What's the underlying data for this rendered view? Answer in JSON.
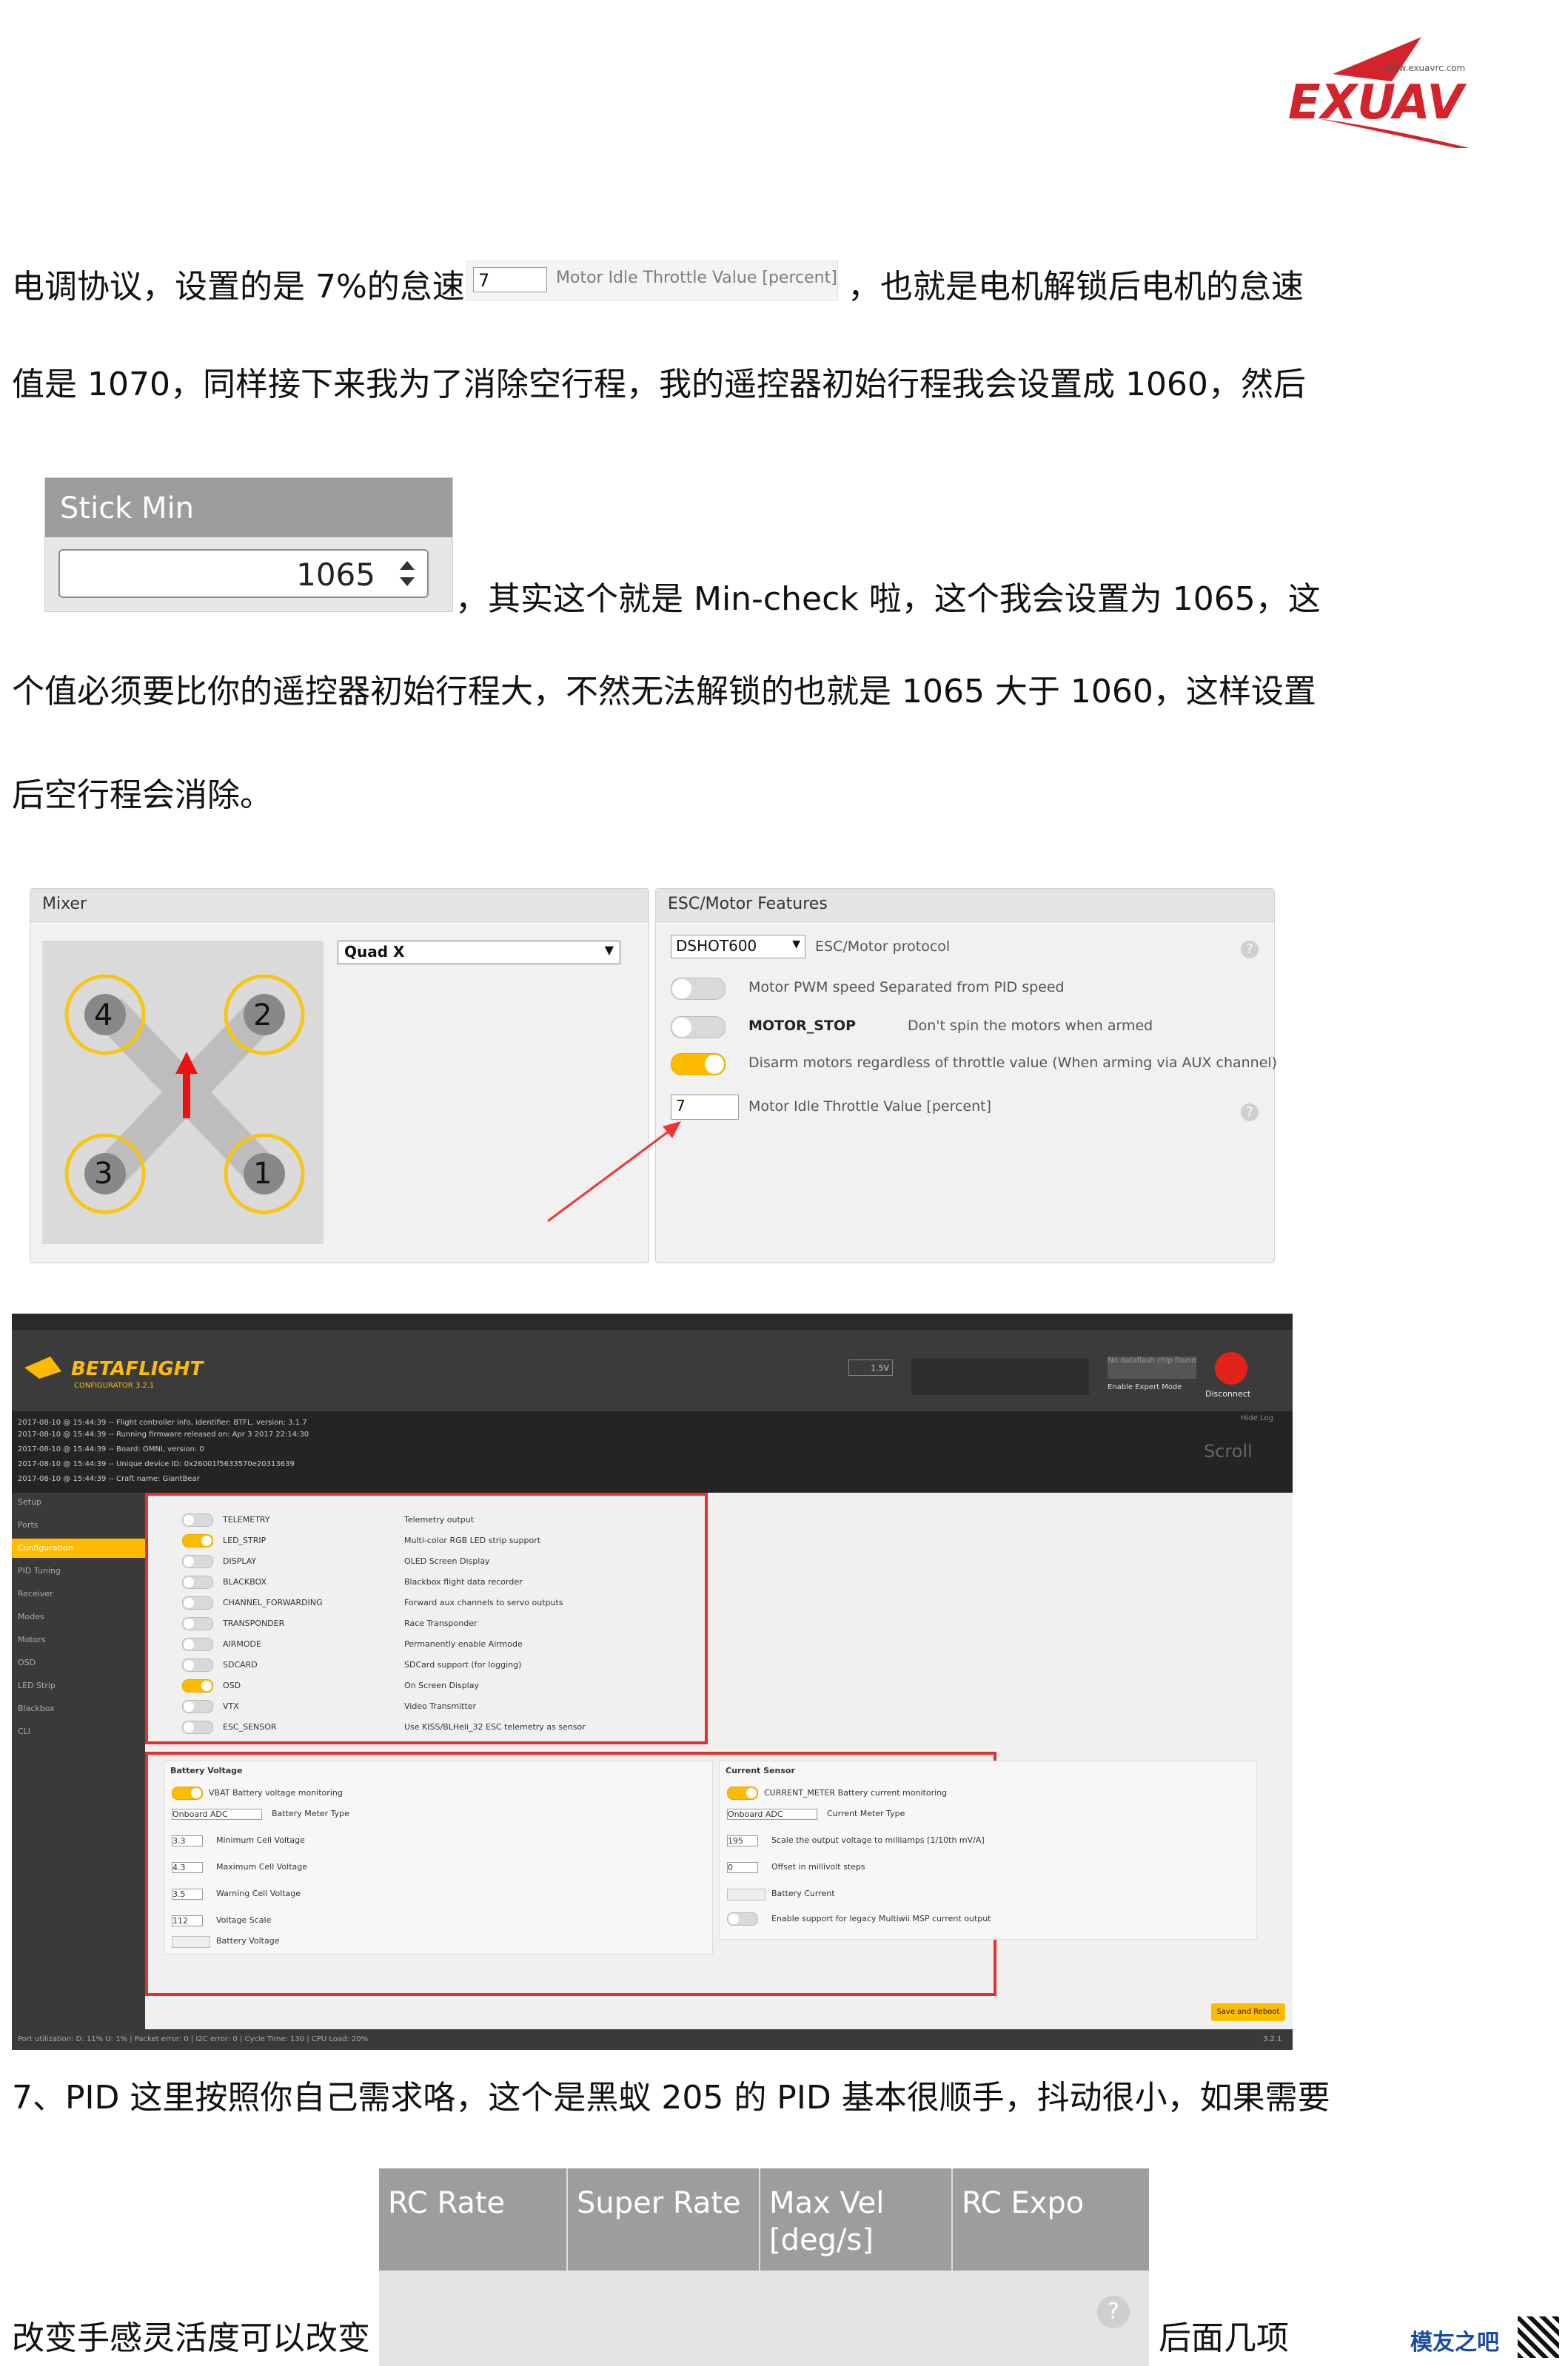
{
  "logo": {
    "text": "EXUAV",
    "url": "www.exuavrc.com",
    "color": "#d4232b"
  },
  "paragraph1": {
    "before": "电调协议，设置的是 7%的怠速",
    "after": "，也就是电机解锁后电机的怠速",
    "line2": "值是 1070，同样接下来我为了消除空行程，我的遥控器初始行程我会设置成 1060，然后"
  },
  "idle_snippet": {
    "value": "7",
    "label": "Motor Idle Throttle Value [percent]"
  },
  "stick_min": {
    "header": "Stick Min",
    "value": "1065"
  },
  "paragraph2": {
    "line1": "，其实这个就是 Min-check 啦，这个我会设置为 1065，这",
    "line2": "个值必须要比你的遥控器初始行程大，不然无法解锁的也就是 1065 大于 1060，这样设置",
    "line3": "后空行程会消除。"
  },
  "mixer": {
    "title": "Mixer",
    "select": "Quad X",
    "motors": [
      "4",
      "2",
      "3",
      "1"
    ],
    "prop_color": "#f5c518",
    "arrow_color": "#e11"
  },
  "esc": {
    "title": "ESC/Motor Features",
    "protocol_value": "DSHOT600",
    "protocol_label": "ESC/Motor protocol",
    "features": [
      {
        "label": "Motor PWM speed Separated from PID speed",
        "on": false
      },
      {
        "label": "MOTOR_STOP",
        "desc": "Don't spin the motors when armed",
        "on": false
      },
      {
        "label": "Disarm motors regardless of throttle value (When arming via AUX channel)",
        "on": true
      }
    ],
    "idle_value": "7",
    "idle_label": "Motor Idle Throttle Value [percent]"
  },
  "betaflight": {
    "brand": "BETAFLIGHT",
    "subtitle": "CONFIGURATOR 3.2.1",
    "voltage": "1.5V",
    "disconnect": "Disconnect",
    "expert": "Enable Expert Mode",
    "no_dataflash": "No dataflash chip found",
    "log": [
      "2017-08-10 @ 15:44:39 -- Flight controller info, identifier: BTFL, version: 3.1.7",
      "2017-08-10 @ 15:44:39 -- Running firmware released on: Apr 3 2017 22:14:30",
      "2017-08-10 @ 15:44:39 -- Board: OMNI, version: 0",
      "2017-08-10 @ 15:44:39 -- Unique device ID: 0x26001f5633570e20313639",
      "2017-08-10 @ 15:44:39 -- Craft name: GiantBear"
    ],
    "scroll_label": "Scroll",
    "hide_log": "Hide Log",
    "nav": [
      "Setup",
      "Ports",
      "Configuration",
      "PID Tuning",
      "Receiver",
      "Modes",
      "Motors",
      "OSD",
      "LED Strip",
      "Blackbox",
      "CLI"
    ],
    "nav_active": 2,
    "features": [
      {
        "name": "TELEMETRY",
        "desc": "Telemetry output",
        "on": false
      },
      {
        "name": "LED_STRIP",
        "desc": "Multi-color RGB LED strip support",
        "on": true
      },
      {
        "name": "DISPLAY",
        "desc": "OLED Screen Display",
        "on": false
      },
      {
        "name": "BLACKBOX",
        "desc": "Blackbox flight data recorder",
        "on": false
      },
      {
        "name": "CHANNEL_FORWARDING",
        "desc": "Forward aux channels to servo outputs",
        "on": false
      },
      {
        "name": "TRANSPONDER",
        "desc": "Race Transponder",
        "on": false
      },
      {
        "name": "AIRMODE",
        "desc": "Permanently enable Airmode",
        "on": false
      },
      {
        "name": "SDCARD",
        "desc": "SDCard support (for logging)",
        "on": false
      },
      {
        "name": "OSD",
        "desc": "On Screen Display",
        "on": true
      },
      {
        "name": "VTX",
        "desc": "Video Transmitter",
        "on": false
      },
      {
        "name": "ESC_SENSOR",
        "desc": "Use KISS/BLHeli_32 ESC telemetry as sensor",
        "on": false
      }
    ],
    "battery": {
      "title": "Battery Voltage",
      "vbat": "VBAT  Battery voltage monitoring",
      "meter_value": "Onboard ADC",
      "meter_label": "Battery Meter Type",
      "rows": [
        {
          "value": "3.3",
          "label": "Minimum Cell Voltage"
        },
        {
          "value": "4.3",
          "label": "Maximum Cell Voltage"
        },
        {
          "value": "3.5",
          "label": "Warning Cell Voltage"
        },
        {
          "value": "112",
          "label": "Voltage Scale"
        },
        {
          "value": "",
          "label": "Battery Voltage"
        }
      ]
    },
    "current": {
      "title": "Current Sensor",
      "meter": "CURRENT_METER  Battery current monitoring",
      "meter_value": "Onboard ADC",
      "meter_label": "Current Meter Type",
      "rows": [
        {
          "value": "195",
          "label": "Scale the output voltage to milliamps [1/10th mV/A]"
        },
        {
          "value": "0",
          "label": "Offset in millivolt steps"
        },
        {
          "value": "",
          "label": "Battery Current"
        }
      ],
      "legacy": "Enable support for legacy Multiwii MSP current output"
    },
    "save": "Save and Reboot",
    "status": "Port utilization: D: 11% U: 1%  |  Packet error: 0  |  I2C error: 0  |  Cycle Time: 130  |  CPU Load: 20%",
    "version": "3.2.1"
  },
  "paragraph3": "7、PID 这里按照你自己需求咯，这个是黑蚁 205 的 PID 基本很顺手，抖动很小，如果需要",
  "rc_table": {
    "headers": [
      "RC Rate",
      "Super Rate",
      "Max Vel [deg/s]",
      "RC Expo"
    ]
  },
  "paragraph4": {
    "before": "改变手感灵活度可以改变",
    "after": "后面几项"
  },
  "footer": {
    "brand": "模友之吧",
    "qr": "qr-code"
  }
}
